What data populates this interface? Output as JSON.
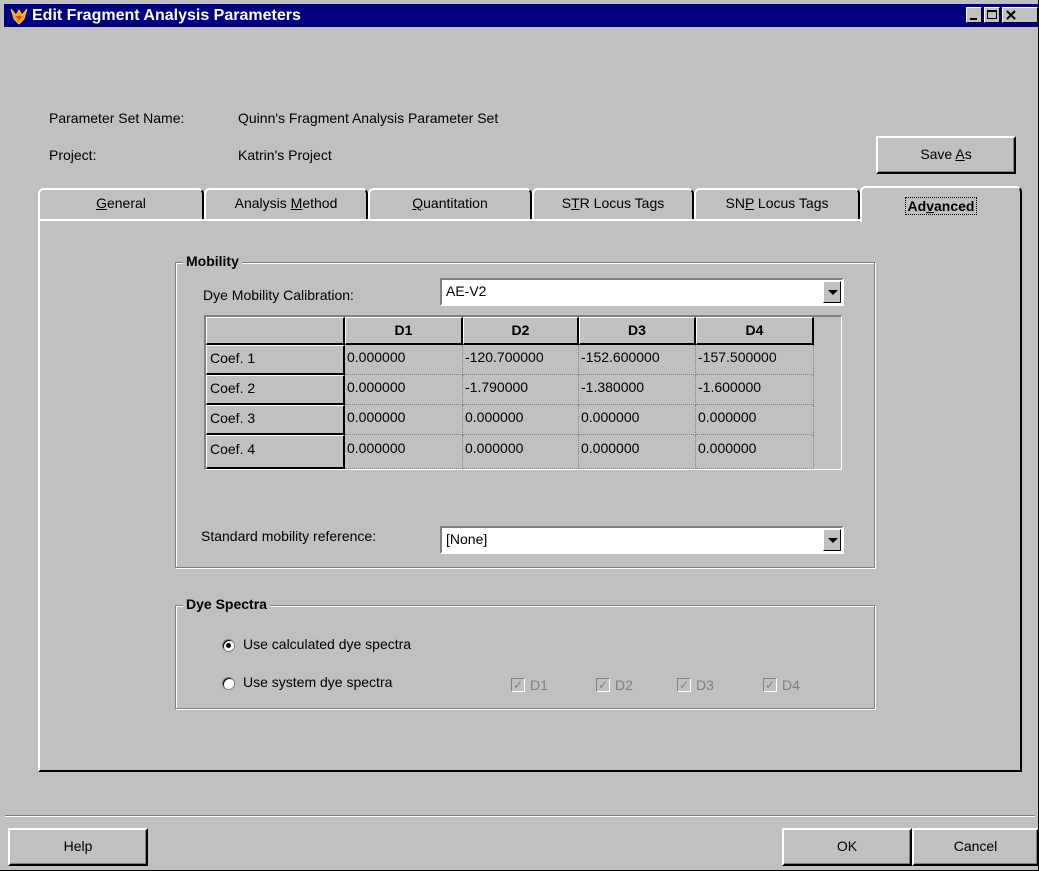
{
  "window": {
    "title": "Edit Fragment Analysis Parameters",
    "minimize": "_",
    "maximize": "□",
    "close": "×"
  },
  "header": {
    "param_set_label": "Parameter Set Name:",
    "param_set_value": "Quinn's Fragment Analysis Parameter Set",
    "project_label": "Project:",
    "project_value": "Katrin's Project",
    "save_as": {
      "pre": "Save ",
      "ul": "A",
      "post": "s"
    }
  },
  "tabs": [
    {
      "pre": "",
      "ul": "G",
      "post": "eneral"
    },
    {
      "pre": "Analysis ",
      "ul": "M",
      "post": "ethod"
    },
    {
      "pre": "",
      "ul": "Q",
      "post": "uantitation"
    },
    {
      "pre": "S",
      "ul": "T",
      "post": "R Locus Tags"
    },
    {
      "pre": "SN",
      "ul": "P",
      "post": " Locus Tags"
    },
    {
      "pre": "Ad",
      "ul": "v",
      "post": "anced"
    }
  ],
  "mobility": {
    "title": "Mobility",
    "calibration_label": "Dye Mobility Calibration:",
    "calibration_value": "AE-V2",
    "columns": [
      "D1",
      "D2",
      "D3",
      "D4"
    ],
    "rows": [
      {
        "label": "Coef. 1",
        "values": [
          "0.000000",
          "-120.700000",
          "-152.600000",
          "-157.500000"
        ]
      },
      {
        "label": "Coef. 2",
        "values": [
          "0.000000",
          "-1.790000",
          "-1.380000",
          "-1.600000"
        ]
      },
      {
        "label": "Coef. 3",
        "values": [
          "0.000000",
          "0.000000",
          "0.000000",
          "0.000000"
        ]
      },
      {
        "label": "Coef. 4",
        "values": [
          "0.000000",
          "0.000000",
          "0.000000",
          "0.000000"
        ]
      }
    ],
    "reference_label": "Standard mobility reference:",
    "reference_value": "[None]"
  },
  "dye_spectra": {
    "title": "Dye Spectra",
    "option_calculated": "Use calculated dye spectra",
    "option_system": "Use system dye spectra",
    "selected": "calculated",
    "checks": [
      "D1",
      "D2",
      "D3",
      "D4"
    ],
    "check_mark": "✓"
  },
  "footer": {
    "help": "Help",
    "ok": "OK",
    "cancel": "Cancel"
  }
}
